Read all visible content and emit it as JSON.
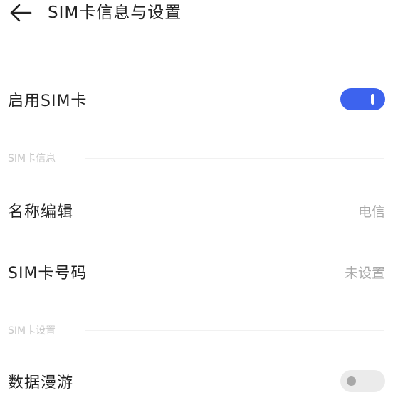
{
  "header": {
    "back_icon": "back-arrow-icon",
    "title": "SIM卡信息与设置"
  },
  "enable_sim": {
    "label": "启用SIM卡",
    "enabled": true
  },
  "sections": {
    "sim_info_title": "SIM卡信息",
    "sim_settings_title": "SIM卡设置"
  },
  "sim_info": {
    "name_edit_label": "名称编辑",
    "name_edit_value": "电信",
    "number_label": "SIM卡号码",
    "number_value": "未设置"
  },
  "sim_settings": {
    "data_roaming_label": "数据漫游",
    "data_roaming_enabled": false
  },
  "colors": {
    "toggle_on": "#3d63ee",
    "toggle_off": "#ebebeb",
    "secondary_text": "#a9a9a9"
  }
}
